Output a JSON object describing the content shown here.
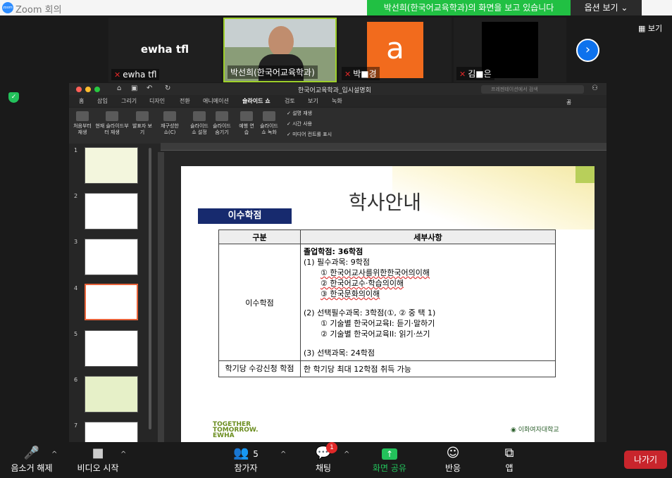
{
  "app": {
    "logo_text": "zoom",
    "title": "Zoom 회의"
  },
  "share_banner": "박선희(한국어교육학과)의 화면을 보고 있습니다",
  "options_button": "옵션 보기",
  "view_button": "보기",
  "participants": [
    {
      "name": "ewha tfl",
      "display": "ewha tfl",
      "muted": true
    },
    {
      "name": "박선희(한국어교육학과)",
      "muted": false
    },
    {
      "name": "박■경",
      "avatar_letter": "a",
      "muted": true
    },
    {
      "name": "김■은",
      "muted": true
    }
  ],
  "ppt": {
    "doc_title": "한국어교육학과_입시설명회",
    "search_placeholder": "프레젠테이션에서 검색",
    "share_label": "공유",
    "tabs": [
      "홈",
      "삽입",
      "그리기",
      "디자인",
      "전환",
      "애니메이션",
      "슬라이드 쇼",
      "검토",
      "보기",
      "녹화"
    ],
    "active_tab": "슬라이드 쇼",
    "ribbon": {
      "b1": "처음부터 재생",
      "b2": "현재 슬라이드부터 재생",
      "b3": "발표자 보기",
      "b4": "재구성한 쇼(C)",
      "b5": "슬라이드 쇼 설정",
      "b6": "슬라이드 숨기기",
      "b7": "예행 연습",
      "b8": "슬라이드 쇼 녹화",
      "c1": "설명 재생",
      "c2": "시간 사용",
      "c3": "미디어 컨트롤 표시"
    },
    "thumb_numbers": [
      "1",
      "2",
      "3",
      "4",
      "5",
      "6",
      "7"
    ],
    "selected_slide": "4"
  },
  "slide": {
    "title": "학사안내",
    "tag": "이수학점",
    "col1": "구분",
    "col2": "세부사항",
    "row1_label": "이수학점",
    "lines": {
      "grad": "졸업학점: 36학점",
      "req": "(1) 필수과목: 9학점",
      "r1": "① 한국어교사를위한한국어의이해",
      "r2": "② 한국어교수·학습의이해",
      "r3": "③ 한국문화의이해",
      "selreq": "(2) 선택필수과목: 3학점(①, ② 중 택 1)",
      "s1": "① 기술별 한국어교육I: 듣기·말하기",
      "s2": "② 기술별 한국어교육II: 읽기·쓰기",
      "elective": "(3) 선택과목: 24학점"
    },
    "row2_label": "학기당 수강신청 학점",
    "row2_value": "한 학기당 최대 12학점 취득 가능",
    "logo_left": "TOGETHER TOMORROW. EWHA",
    "logo_right": "이화여자대학교"
  },
  "toolbar": {
    "mute": "음소거 해제",
    "video": "비디오 시작",
    "participants": "참가자",
    "participant_count": "5",
    "chat": "채팅",
    "chat_badge": "1",
    "share": "화면 공유",
    "reactions": "반응",
    "apps": "앱",
    "leave": "나가기"
  }
}
